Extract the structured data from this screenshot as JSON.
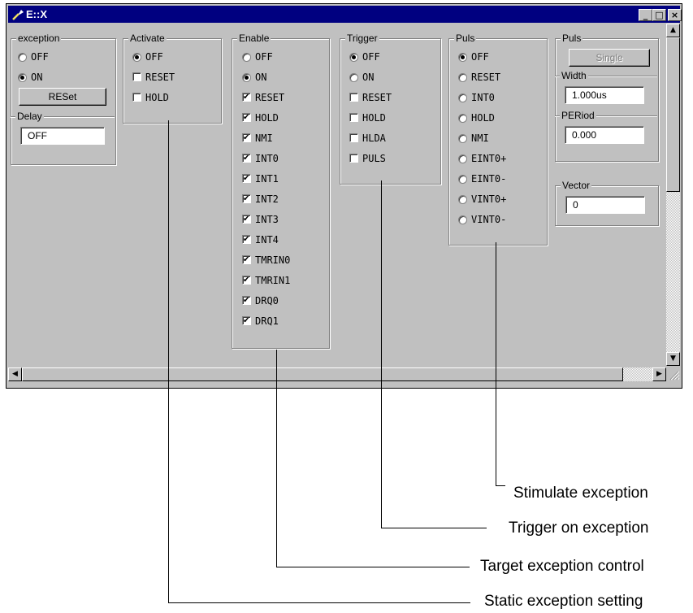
{
  "window": {
    "title": "E::X",
    "controls": {
      "minimize": "_",
      "maximize": "□",
      "close": "×"
    }
  },
  "groups": {
    "exception": {
      "title": "exception",
      "options": [
        {
          "label": "OFF",
          "selected": false
        },
        {
          "label": "ON",
          "selected": true
        }
      ],
      "reset_button": "RESet",
      "delay_title": "Delay",
      "delay_value": "OFF"
    },
    "activate": {
      "title": "Activate",
      "options": [
        {
          "label": "OFF",
          "kind": "radio",
          "checked": true
        },
        {
          "label": "RESET",
          "kind": "check",
          "checked": false
        },
        {
          "label": "HOLD",
          "kind": "check",
          "checked": false
        }
      ]
    },
    "enable": {
      "title": "Enable",
      "options": [
        {
          "label": "OFF",
          "kind": "radio",
          "checked": false
        },
        {
          "label": "ON",
          "kind": "radio",
          "checked": true
        },
        {
          "label": "RESET",
          "kind": "check",
          "checked": true
        },
        {
          "label": "HOLD",
          "kind": "check",
          "checked": true
        },
        {
          "label": "NMI",
          "kind": "check",
          "checked": true
        },
        {
          "label": "INT0",
          "kind": "check",
          "checked": true
        },
        {
          "label": "INT1",
          "kind": "check",
          "checked": true
        },
        {
          "label": "INT2",
          "kind": "check",
          "checked": true
        },
        {
          "label": "INT3",
          "kind": "check",
          "checked": true
        },
        {
          "label": "INT4",
          "kind": "check",
          "checked": true
        },
        {
          "label": "TMRIN0",
          "kind": "check",
          "checked": true
        },
        {
          "label": "TMRIN1",
          "kind": "check",
          "checked": true
        },
        {
          "label": "DRQ0",
          "kind": "check",
          "checked": true
        },
        {
          "label": "DRQ1",
          "kind": "check",
          "checked": true
        }
      ]
    },
    "trigger": {
      "title": "Trigger",
      "options": [
        {
          "label": "OFF",
          "kind": "radio",
          "checked": true
        },
        {
          "label": "ON",
          "kind": "radio",
          "checked": false
        },
        {
          "label": "RESET",
          "kind": "check",
          "checked": false
        },
        {
          "label": "HOLD",
          "kind": "check",
          "checked": false
        },
        {
          "label": "HLDA",
          "kind": "check",
          "checked": false
        },
        {
          "label": "PULS",
          "kind": "check",
          "checked": false
        }
      ]
    },
    "puls": {
      "title": "Puls",
      "options": [
        {
          "label": "OFF",
          "checked": true
        },
        {
          "label": "RESET",
          "checked": false
        },
        {
          "label": "INT0",
          "checked": false
        },
        {
          "label": "HOLD",
          "checked": false
        },
        {
          "label": "NMI",
          "checked": false
        },
        {
          "label": "EINT0+",
          "checked": false
        },
        {
          "label": "EINT0-",
          "checked": false
        },
        {
          "label": "VINT0+",
          "checked": false
        },
        {
          "label": "VINT0-",
          "checked": false
        }
      ]
    },
    "puls2": {
      "title": "Puls",
      "single_button": "Single",
      "width_title": "Width",
      "width_value": "1.000us",
      "period_title": "PERiod",
      "period_value": "0.000",
      "vector_title": "Vector",
      "vector_value": "0"
    }
  },
  "callouts": {
    "stimulate": "Stimulate exception",
    "trigger": "Trigger on exception",
    "target": "Target exception control",
    "static": "Static exception setting"
  }
}
